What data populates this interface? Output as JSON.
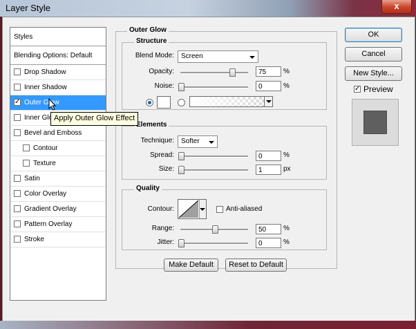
{
  "window": {
    "title": "Layer Style",
    "close_glyph": "x"
  },
  "styles_panel": {
    "header": "Styles",
    "blending_options": "Blending Options: Default",
    "items": [
      {
        "label": "Drop Shadow",
        "checked": false
      },
      {
        "label": "Inner Shadow",
        "checked": false
      },
      {
        "label": "Outer Glow",
        "checked": true
      },
      {
        "label": "Inner Glow",
        "checked": false
      },
      {
        "label": "Bevel and Emboss",
        "checked": false
      },
      {
        "label": "Contour",
        "checked": false
      },
      {
        "label": "Texture",
        "checked": false
      },
      {
        "label": "Satin",
        "checked": false
      },
      {
        "label": "Color Overlay",
        "checked": false
      },
      {
        "label": "Gradient Overlay",
        "checked": false
      },
      {
        "label": "Pattern Overlay",
        "checked": false
      },
      {
        "label": "Stroke",
        "checked": false
      }
    ],
    "selected": "Outer Glow",
    "tooltip": "Apply Outer Glow Effect"
  },
  "outer_glow": {
    "title": "Outer Glow",
    "structure": {
      "title": "Structure",
      "blend_mode_label": "Blend Mode:",
      "blend_mode_value": "Screen",
      "opacity_label": "Opacity:",
      "opacity_value": "75",
      "opacity_unit": "%",
      "opacity_level": 0.75,
      "noise_label": "Noise:",
      "noise_value": "0",
      "noise_unit": "%",
      "color_mode": "solid",
      "glow_color": "#ffffff"
    },
    "elements": {
      "title": "Elements",
      "technique_label": "Technique:",
      "technique_value": "Softer",
      "spread_label": "Spread:",
      "spread_value": "0",
      "spread_unit": "%",
      "size_label": "Size:",
      "size_value": "1",
      "size_unit": "px"
    },
    "quality": {
      "title": "Quality",
      "contour_label": "Contour:",
      "anti_aliased_label": "Anti-aliased",
      "anti_aliased_checked": false,
      "range_label": "Range:",
      "range_value": "50",
      "range_unit": "%",
      "jitter_label": "Jitter:",
      "jitter_value": "0",
      "jitter_unit": "%"
    },
    "make_default": "Make Default",
    "reset_to_default": "Reset to Default"
  },
  "actions": {
    "ok": "OK",
    "cancel": "Cancel",
    "new_style": "New Style...",
    "preview_label": "Preview",
    "preview_checked": true
  },
  "colors": {
    "selection": "#3399ff",
    "dialog_bg": "#f0f0f0",
    "tooltip_bg": "#ffffe1",
    "preview_swatch": "#5f5f5f"
  }
}
